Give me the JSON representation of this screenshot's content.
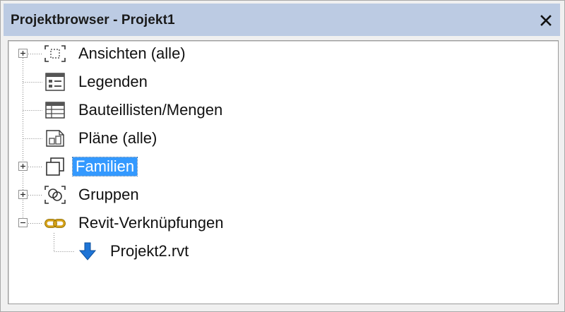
{
  "window": {
    "title": "Projektbrowser - Projekt1",
    "close_glyph": "✕"
  },
  "tree": {
    "items": [
      {
        "label": "Ansichten (alle)",
        "icon": "views-icon",
        "expander": "plus",
        "selected": false
      },
      {
        "label": "Legenden",
        "icon": "legend-icon",
        "expander": "none",
        "selected": false
      },
      {
        "label": "Bauteillisten/Mengen",
        "icon": "schedule-icon",
        "expander": "none",
        "selected": false
      },
      {
        "label": "Pläne (alle)",
        "icon": "sheets-icon",
        "expander": "none",
        "selected": false
      },
      {
        "label": "Familien",
        "icon": "families-icon",
        "expander": "plus",
        "selected": true
      },
      {
        "label": "Gruppen",
        "icon": "groups-icon",
        "expander": "plus",
        "selected": false
      },
      {
        "label": "Revit-Verknüpfungen",
        "icon": "link-chain-icon",
        "expander": "minus",
        "selected": false
      }
    ],
    "children": [
      {
        "label": "Projekt2.rvt",
        "icon": "arrow-down-icon",
        "parent": "Revit-Verknüpfungen"
      }
    ]
  },
  "colors": {
    "titlebar": "#bccbe3",
    "selection": "#3399ff",
    "link_icon": "#d4a017",
    "arrow_icon": "#1e74d6"
  }
}
